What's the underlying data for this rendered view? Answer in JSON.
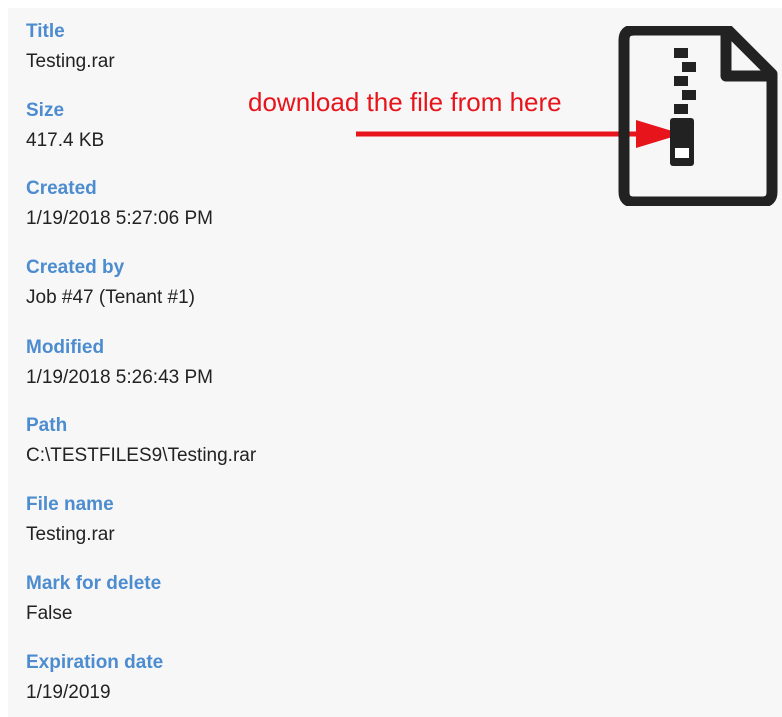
{
  "properties": [
    {
      "label": "Title",
      "value": "Testing.rar"
    },
    {
      "label": "Size",
      "value": "417.4 KB"
    },
    {
      "label": "Created",
      "value": "1/19/2018 5:27:06 PM"
    },
    {
      "label": "Created by",
      "value": "Job #47 (Tenant #1)"
    },
    {
      "label": "Modified",
      "value": "1/19/2018 5:26:43 PM"
    },
    {
      "label": "Path",
      "value": "C:\\TESTFILES9\\Testing.rar"
    },
    {
      "label": "File name",
      "value": "Testing.rar"
    },
    {
      "label": "Mark for delete",
      "value": "False"
    },
    {
      "label": "Expiration date",
      "value": "1/19/2019"
    }
  ],
  "annotation": {
    "text": "download the file from here",
    "color": "#e8141b"
  },
  "file_icon": {
    "icon": "zip-file-icon",
    "color": "#222222"
  },
  "colors": {
    "label": "#4c8ccf",
    "value": "#222222",
    "background": "#f7f7f8"
  }
}
